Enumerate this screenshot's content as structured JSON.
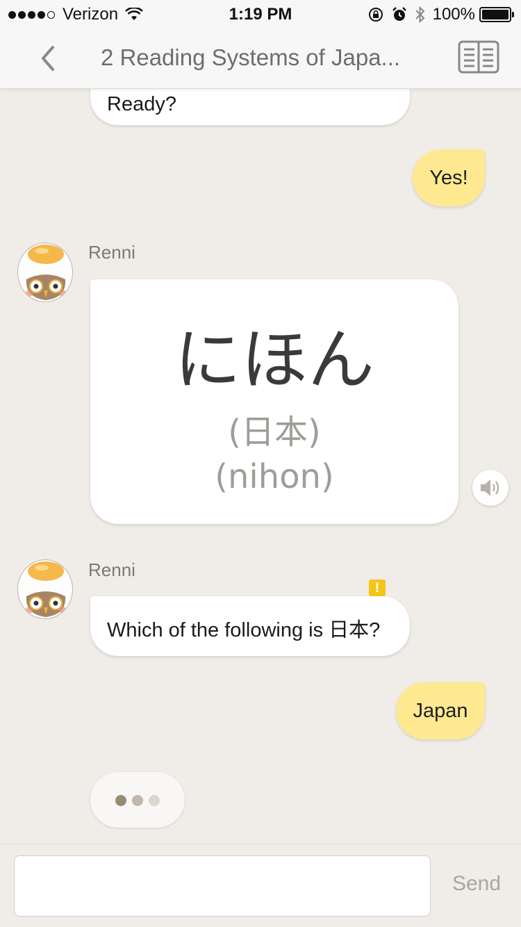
{
  "status_bar": {
    "carrier": "Verizon",
    "time": "1:19 PM",
    "battery": "100%"
  },
  "nav": {
    "title": "2 Reading Systems of Japa..."
  },
  "messages": {
    "prev_bot_text": "Ready?",
    "user_reply_1": "Yes!",
    "bot_1": {
      "sender": "Renni",
      "kana": "にほん",
      "kanji": "(日本)",
      "romaji": "(nihon)"
    },
    "bot_2": {
      "sender": "Renni",
      "hint": "!",
      "text": "Which of the following is 日本?"
    },
    "user_reply_2": "Japan"
  },
  "composer": {
    "placeholder": "",
    "send_label": "Send"
  },
  "colors": {
    "background": "#f0ece8",
    "user_bubble": "#fee991",
    "hint": "#f5c518",
    "typing_dots": [
      "#9a8a74",
      "#c2b7a8",
      "#dcd6cf"
    ]
  }
}
